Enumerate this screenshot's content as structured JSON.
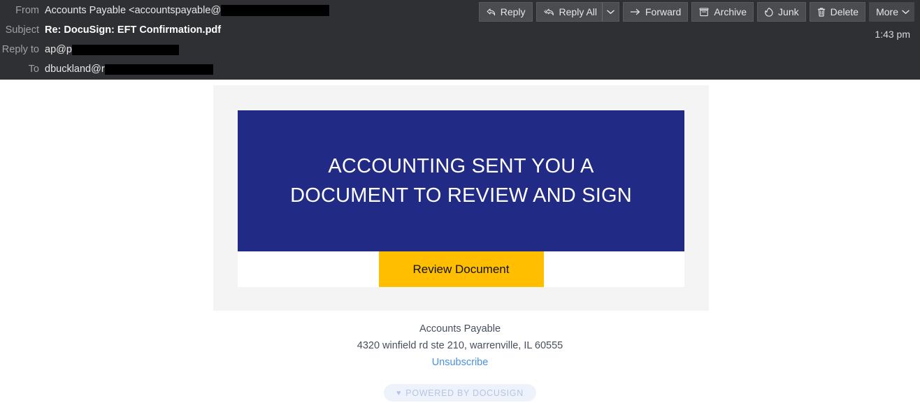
{
  "header": {
    "fields": [
      {
        "label": "From",
        "value": "Accounts Payable <accountspayable@",
        "redacted": true,
        "trailing": ""
      },
      {
        "label": "Subject",
        "value": "Re: DocuSign: EFT Confirmation.pdf",
        "redacted": false,
        "trailing": ""
      },
      {
        "label": "Reply to",
        "value": "ap@p",
        "redacted": true,
        "trailing": ""
      },
      {
        "label": "To",
        "value": "dbuckland@r",
        "redacted": true,
        "trailing": ""
      }
    ],
    "from_label": "From",
    "from_value": "Accounts Payable <accountspayable@",
    "subject_label": "Subject",
    "subject_value": "Re: DocuSign: EFT Confirmation.pdf",
    "replyto_label": "Reply to",
    "replyto_value": "ap@p",
    "to_label": "To",
    "to_value": "dbuckland@r",
    "timestamp": "1:43 pm"
  },
  "toolbar": {
    "reply": "Reply",
    "reply_all": "Reply All",
    "reply_all_caret": "⌄",
    "forward": "Forward",
    "archive": "Archive",
    "junk": "Junk",
    "delete": "Delete",
    "more": "More",
    "more_caret": "⌄",
    "icons": {
      "reply": "reply-icon",
      "reply_all": "reply-all-icon",
      "forward": "forward-arrow-icon",
      "archive": "archive-box-icon",
      "junk": "junk-flame-icon",
      "delete": "trash-icon"
    }
  },
  "email": {
    "banner_line1": "ACCOUNTING SENT YOU A",
    "banner_line2": "DOCUMENT TO REVIEW AND SIGN",
    "cta_label": "Review Document",
    "footer_name": "Accounts Payable",
    "footer_address": "4320 winfield rd ste 210, warrenville, IL 60555",
    "unsubscribe": "Unsubscribe",
    "powered_heart": "♥",
    "powered_label": "POWERED BY DOCUSIGN"
  },
  "colors": {
    "header_bg": "#2f3033",
    "banner_blue": "#212a85",
    "cta_yellow": "#ffbf00",
    "card_gray": "#f4f4f5",
    "link_blue": "#4a90e2",
    "badge_bg": "#eef2fb",
    "badge_text": "#b7c4e4"
  }
}
